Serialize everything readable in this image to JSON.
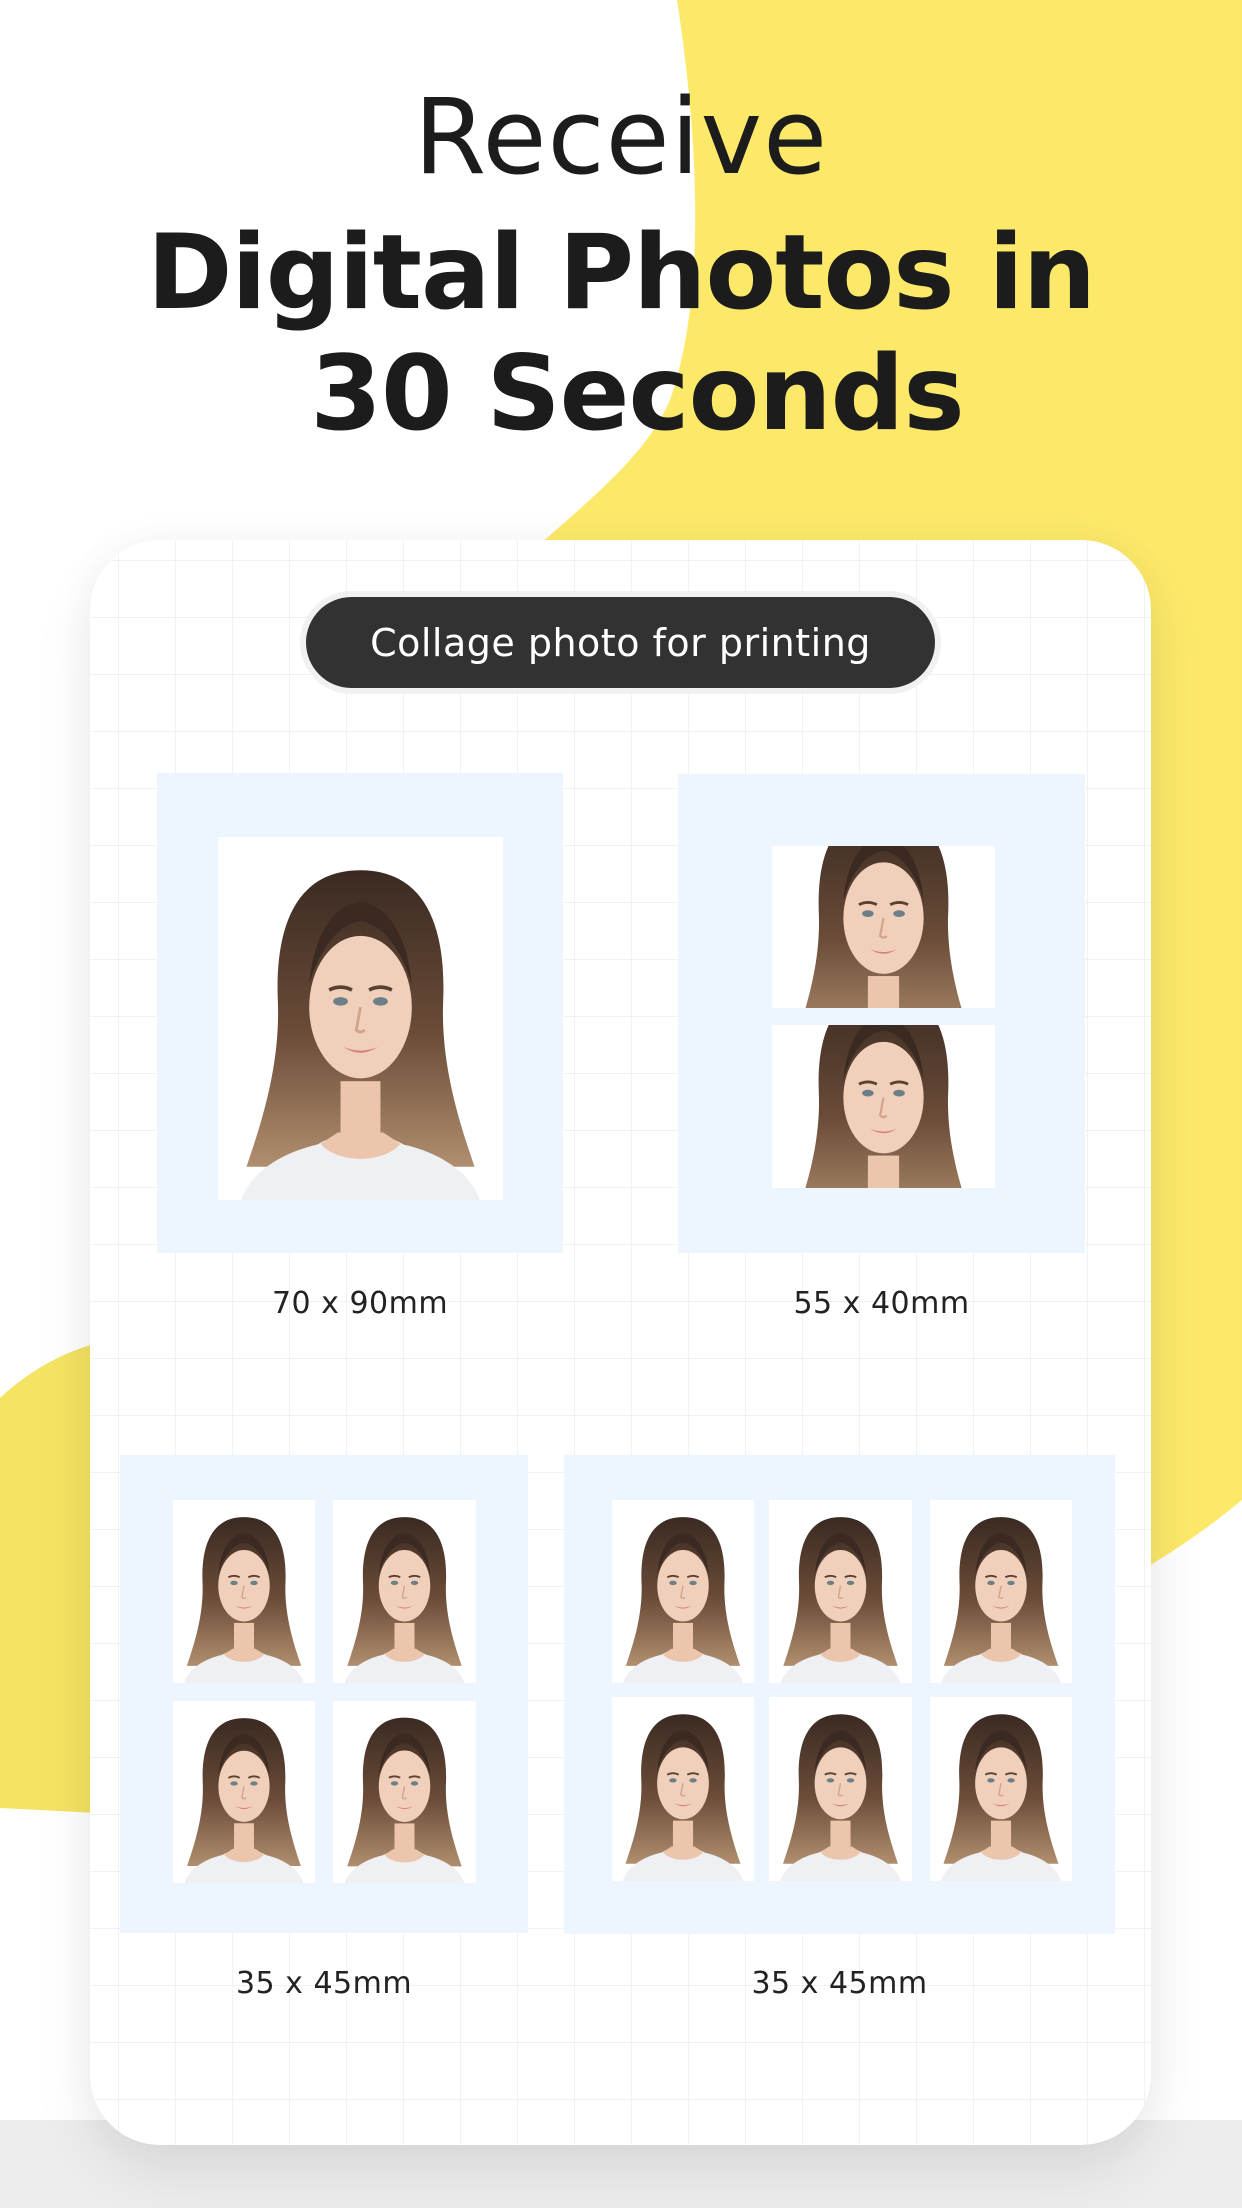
{
  "headline": {
    "line1": "Receive",
    "line2": "Digital Photos in",
    "line3": "30 Seconds"
  },
  "card": {
    "title_button": "Collage photo for printing",
    "layouts": [
      {
        "size_label": "70 x 90mm",
        "photo_count": 1,
        "columns": 1,
        "rows": 1
      },
      {
        "size_label": "55 x 40mm",
        "photo_count": 2,
        "columns": 1,
        "rows": 2
      },
      {
        "size_label": "35 x 45mm",
        "photo_count": 4,
        "columns": 2,
        "rows": 2
      },
      {
        "size_label": "35 x 45mm",
        "photo_count": 6,
        "columns": 3,
        "rows": 2
      }
    ]
  },
  "colors": {
    "accent_yellow": "#FCE96A",
    "pill_background": "#323232",
    "panel_background": "#EDF5FF",
    "text_dark": "#1C1C1C"
  },
  "icons": {
    "portrait": "portrait-photo"
  }
}
